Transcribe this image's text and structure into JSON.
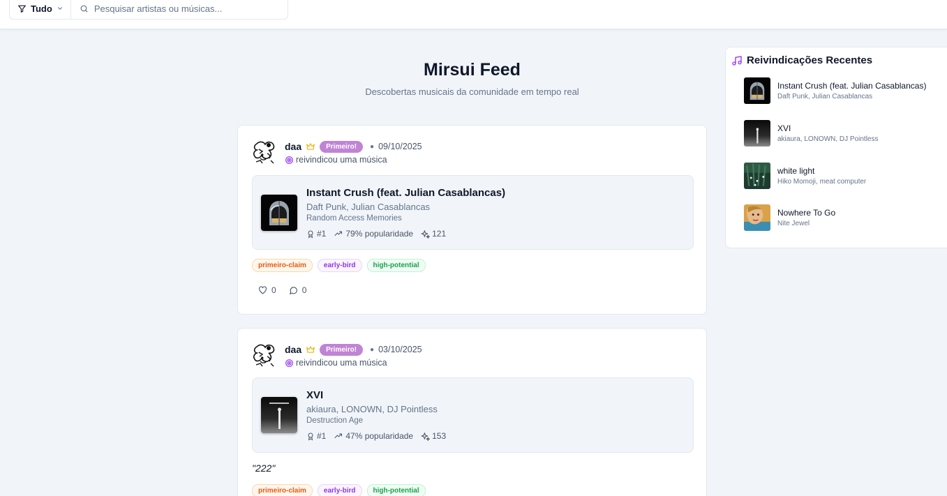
{
  "topbar": {
    "filter_label": "Tudo",
    "search_placeholder": "Pesquisar artistas ou músicas..."
  },
  "header": {
    "title": "Mirsui Feed",
    "subtitle": "Descobertas musicais da comunidade em tempo real"
  },
  "posts": [
    {
      "username": "daa",
      "badge": "Primeiro!",
      "date": "09/10/2025",
      "action": "reivindicou uma música",
      "track": {
        "title": "Instant Crush (feat. Julian Casablancas)",
        "artists": "Daft Punk, Julian Casablancas",
        "album": "Random Access Memories",
        "rank": "#1",
        "popularity": "79% popularidade",
        "score": "121"
      },
      "tags": [
        "primeiro-claim",
        "early-bird",
        "high-potential"
      ],
      "likes": "0",
      "comments": "0"
    },
    {
      "username": "daa",
      "badge": "Primeiro!",
      "date": "03/10/2025",
      "action": "reivindicou uma música",
      "track": {
        "title": "XVI",
        "artists": "akiaura, LONOWN, DJ Pointless",
        "album": "Destruction Age",
        "rank": "#1",
        "popularity": "47% popularidade",
        "score": "153"
      },
      "quote": "\"222\"",
      "tags": [
        "primeiro-claim",
        "early-bird",
        "high-potential"
      ]
    }
  ],
  "sidebar": {
    "title": "Reivindicações Recentes",
    "items": [
      {
        "title": "Instant Crush (feat. Julian Casablancas)",
        "artists": "Daft Punk, Julian Casablancas"
      },
      {
        "title": "XVI",
        "artists": "akiaura, LONOWN, DJ Pointless"
      },
      {
        "title": "white light",
        "artists": "Hiko Momoji, meat computer"
      },
      {
        "title": "Nowhere To Go",
        "artists": "Nite Jewel"
      }
    ]
  },
  "colors": {
    "background": "#f1f5f9",
    "badge": "#c084d4",
    "accent_purple": "#9333ea",
    "crown": "#eab308"
  }
}
